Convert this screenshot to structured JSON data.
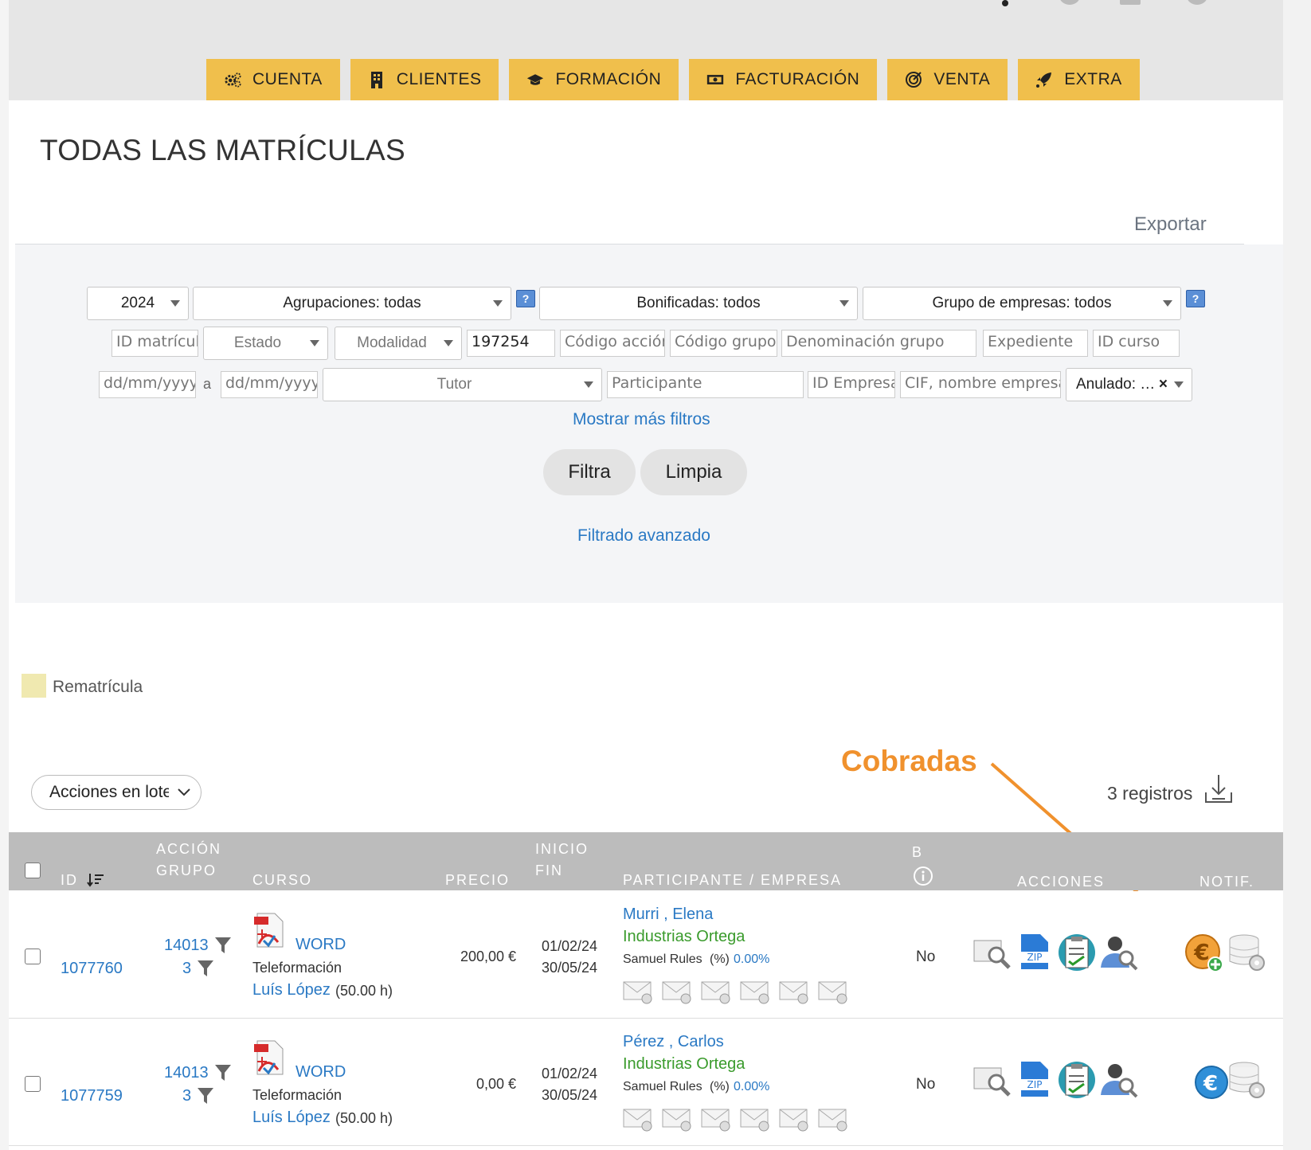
{
  "nav": {
    "tabs": [
      {
        "label": "CUENTA",
        "icon": "gears-icon"
      },
      {
        "label": "CLIENTES",
        "icon": "building-icon"
      },
      {
        "label": "FORMACIÓN",
        "icon": "graduation-cap-icon"
      },
      {
        "label": "FACTURACIÓN",
        "icon": "money-bill-icon"
      },
      {
        "label": "VENTA",
        "icon": "target-icon"
      },
      {
        "label": "EXTRA",
        "icon": "rocket-icon"
      }
    ]
  },
  "page": {
    "title": "TODAS LAS MATRÍCULAS",
    "export_label": "Exportar"
  },
  "filters": {
    "year": "2024",
    "agrupaciones": "Agrupaciones: todas",
    "bonificadas": "Bonificadas: todos",
    "grupo_empresas": "Grupo de empresas: todos",
    "help_label": "?",
    "id_matricula_placeholder": "ID matrícula",
    "estado": "Estado",
    "modalidad": "Modalidad",
    "id_value": "197254",
    "codigo_accion_placeholder": "Código acción",
    "codigo_grupo_placeholder": "Código grupo",
    "denominacion_grupo_placeholder": "Denominación grupo",
    "expediente_placeholder": "Expediente",
    "id_curso_placeholder": "ID curso",
    "fecha_desde_placeholder": "dd/mm/yyyy",
    "fecha_sep": "a",
    "fecha_hasta_placeholder": "dd/mm/yyyy",
    "tutor": "Tutor",
    "participante_placeholder": "Participante",
    "id_empresa_placeholder": "ID Empresa",
    "cif_placeholder": "CIF, nombre empresa",
    "anulado": "Anulado: …",
    "clear_glyph": "×",
    "more_filters": "Mostrar más filtros",
    "filter_button": "Filtra",
    "clear_button": "Limpia",
    "advanced": "Filtrado avanzado"
  },
  "legend": {
    "rematricula": "Rematrícula"
  },
  "list": {
    "batch_actions": "Acciones en lote",
    "count": "3 registros",
    "annotation": "Cobradas",
    "headers": {
      "id": "ID",
      "accion": "ACCIÓN",
      "grupo": "GRUPO",
      "curso": "CURSO",
      "precio": "PRECIO",
      "inicio": "INICIO",
      "fin": "FIN",
      "participante": "PARTICIPANTE / EMPRESA",
      "b": "B",
      "acciones": "ACCIONES",
      "notif": "NOTIF."
    },
    "rows": [
      {
        "id": "1077760",
        "accion": "14013",
        "grupo": "3",
        "curso": "WORD",
        "modalidad": "Teleformación",
        "tutor": "Luís López",
        "horas": "(50.00 h)",
        "precio": "200,00 €",
        "inicio": "01/02/24",
        "fin": "30/05/24",
        "participante": "Murri , Elena",
        "empresa": "Industrias Ortega",
        "comercial": "Samuel Rules",
        "pct_label": "(%)",
        "pct": "0.00%",
        "bonificada": "No",
        "cobro_icon": "euro-add-icon",
        "cobrada": true
      },
      {
        "id": "1077759",
        "accion": "14013",
        "grupo": "3",
        "curso": "WORD",
        "modalidad": "Teleformación",
        "tutor": "Luís López",
        "horas": "(50.00 h)",
        "precio": "0,00 €",
        "inicio": "01/02/24",
        "fin": "30/05/24",
        "participante": "Pérez , Carlos",
        "empresa": "Industrias Ortega",
        "comercial": "Samuel Rules",
        "pct_label": "(%)",
        "pct": "0.00%",
        "bonificada": "No",
        "cobro_icon": "euro-icon",
        "cobrada": false
      }
    ]
  },
  "colors": {
    "tab": "#f0bf4c",
    "link": "#2a79c4",
    "company": "#3a9b2c",
    "annotation": "#f0912d",
    "header": "#bcbcbc"
  }
}
